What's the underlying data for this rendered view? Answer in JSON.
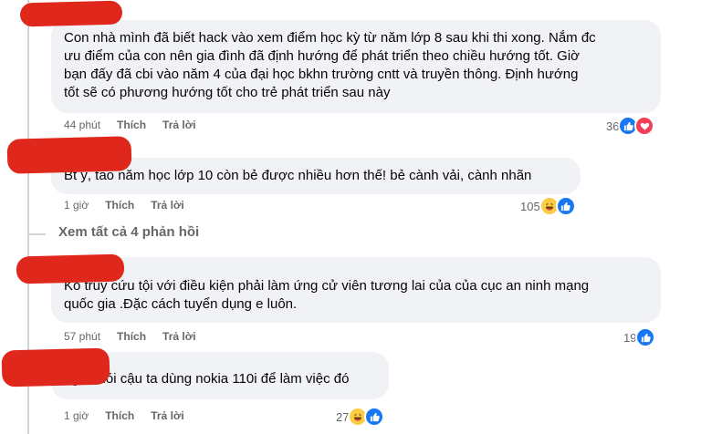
{
  "comments": [
    {
      "text": "Con nhà mình đã biết hack vào xem điểm học kỳ từ năm lớp 8 sau khi thi xong. Nắm đc\nưu điểm của con nên gia đình đã định hướng để phát triển theo chiều hướng tốt. Giờ\nbạn đấy đã cbi vào năm 4 của đại học bkhn trường cntt và truyền thông. Định hướng\ntốt sẽ có phương hướng tốt cho trẻ phát triển sau này",
      "time": "44 phút",
      "like_label": "Thích",
      "reply_label": "Trả lời",
      "reaction_count": "36",
      "reactions": [
        "like-icon",
        "love-icon"
      ]
    },
    {
      "text": "Bt ý, tao năm học lớp 10 còn bẻ được nhiều hơn thế! bẻ cành vải, cành nhãn",
      "time": "1 giờ",
      "like_label": "Thích",
      "reply_label": "Trả lời",
      "reaction_count": "105",
      "reactions": [
        "haha-icon",
        "like-icon"
      ]
    },
    {
      "text": "Ko truy cứu tội với điều kiện phải làm ứng cử viên tương lai của của cục an ninh mạng\nquốc gia .Đặc cách tuyển dụng e luôn.",
      "time": "57 phút",
      "like_label": "Thích",
      "reply_label": "Trả lời",
      "reaction_count": "19",
      "reactions": [
        "like-icon"
      ]
    },
    {
      "text": "nghe nói cậu ta dùng nokia 110i để làm việc đó",
      "time": "1 giờ",
      "like_label": "Thích",
      "reply_label": "Trả lời",
      "reaction_count": "27",
      "reactions": [
        "haha-icon",
        "like-icon"
      ]
    }
  ],
  "view_all_replies": "Xem tất cả 4 phản hồi",
  "colors": {
    "bubble": "#f0f2f5",
    "meta_text": "#65676b",
    "like": "#1877f2",
    "love": "#f33e58",
    "haha": "#fbcd45",
    "redaction": "#e0271c"
  }
}
